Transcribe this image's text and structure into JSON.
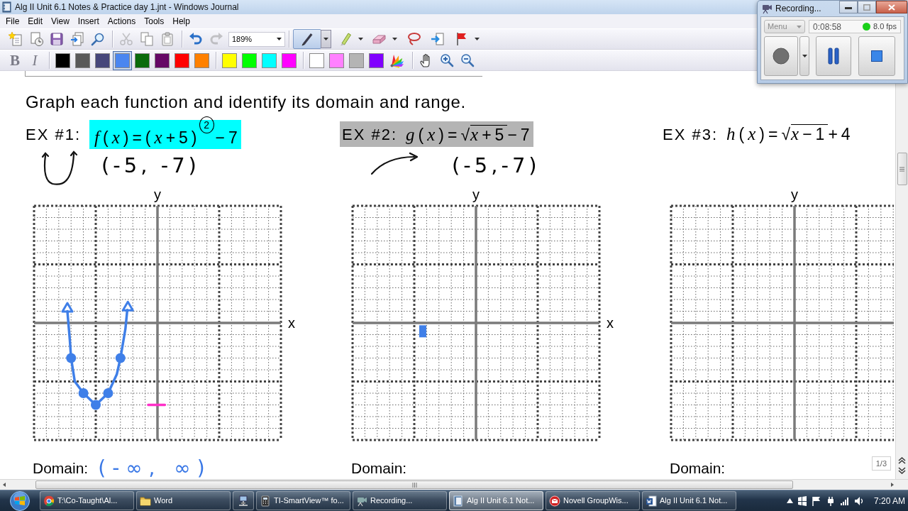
{
  "window": {
    "title": "Alg II Unit 6.1 Notes & Practice day 1.jnt - Windows Journal"
  },
  "menu": [
    "File",
    "Edit",
    "View",
    "Insert",
    "Actions",
    "Tools",
    "Help"
  ],
  "toolbar": {
    "groups": [
      [
        {
          "kind": "new-note",
          "disabled": false
        },
        {
          "kind": "open",
          "disabled": false
        },
        {
          "kind": "save",
          "disabled": false
        },
        {
          "kind": "send",
          "disabled": false
        },
        {
          "kind": "find",
          "disabled": false
        }
      ],
      [
        {
          "kind": "cut",
          "disabled": true
        },
        {
          "kind": "copy",
          "disabled": false
        },
        {
          "kind": "paste",
          "disabled": false
        }
      ],
      [
        {
          "kind": "undo",
          "disabled": false
        },
        {
          "kind": "redo",
          "disabled": true
        }
      ]
    ],
    "zoom": "189%",
    "tools": [
      {
        "kind": "pen",
        "selected": true,
        "dropdown": true
      },
      {
        "kind": "highlighter",
        "selected": false,
        "dropdown": true
      },
      {
        "kind": "eraser",
        "selected": false,
        "dropdown": true
      },
      {
        "kind": "lasso",
        "selected": false,
        "dropdown": false
      },
      {
        "kind": "insert-space",
        "selected": false,
        "dropdown": false
      },
      {
        "kind": "flag",
        "selected": false,
        "dropdown": true
      }
    ]
  },
  "format_bar": {
    "buttons": [
      {
        "label": "B",
        "disabled": true
      },
      {
        "label": "I",
        "disabled": true
      }
    ],
    "color_groups": [
      [
        {
          "color": "#000000",
          "selected": false
        },
        {
          "color": "#595959",
          "selected": false
        },
        {
          "color": "#46467a",
          "selected": false
        },
        {
          "color": "#4a86f0",
          "selected": true
        },
        {
          "color": "#0b6b0b",
          "selected": false
        },
        {
          "color": "#660866",
          "selected": false
        },
        {
          "color": "#ff0000",
          "selected": false
        },
        {
          "color": "#ff8000",
          "selected": false
        }
      ],
      [
        {
          "color": "#ffff00",
          "selected": false
        },
        {
          "color": "#00ff00",
          "selected": false
        },
        {
          "color": "#00ffff",
          "selected": false
        },
        {
          "color": "#ff00ff",
          "selected": false
        }
      ],
      [
        {
          "color": "#ffffff",
          "selected": false
        },
        {
          "color": "#ff80ff",
          "selected": false
        },
        {
          "color": "#b4b4b4",
          "selected": false
        },
        {
          "color": "#8000ff",
          "selected": false
        }
      ]
    ]
  },
  "page": {
    "instruction": "Graph each function and identify its domain and range.",
    "examples": [
      {
        "label": "EX #1:",
        "formula": {
          "before": "*f*(*x*)=(*x*+5)$^{2}$−7"
        },
        "exponent_circled": true,
        "highlight": {
          "color": "#00ffff",
          "kind": "formula"
        },
        "sketch": {
          "kind": "parabola"
        },
        "vertex_note": "(-5, -7)",
        "graph": {
          "y_label": "y",
          "x_label": "x",
          "kind": "parabola"
        },
        "domain": {
          "label": "Domain:",
          "answer": "(-∞, ∞)"
        }
      },
      {
        "label": "EX #2:",
        "formula": {
          "before": "*g*(*x*)=√",
          "radicand": "*x*+5",
          "after": "−7"
        },
        "highlight": {
          "color": "#b4b4b4",
          "kind": "band"
        },
        "sketch": {
          "kind": "arrow"
        },
        "vertex_note": "(-5,-7)",
        "graph": {
          "y_label": "y",
          "x_label": "x",
          "kind": "cursor"
        },
        "domain": {
          "label": "Domain:"
        }
      },
      {
        "label": "EX #3:",
        "formula": {
          "before": "*h*(*x*)=√",
          "radicand": "*x*−1",
          "after": "+4"
        },
        "graph": {
          "y_label": "y"
        },
        "domain": {
          "label": "Domain:"
        }
      }
    ]
  },
  "page_indicator": "1/3",
  "recorder": {
    "title": "Recording...",
    "menu": {
      "label": "Menu",
      "disabled": true
    },
    "time": "0:08:58",
    "recording": true,
    "fps": "8.0 fps"
  },
  "taskbar": {
    "items": [
      {
        "kind": "browser",
        "label": "T:\\Co-Taught\\Al...",
        "selected": false
      },
      {
        "kind": "folder",
        "label": "Word",
        "selected": false
      },
      {
        "kind": "network",
        "selected": false
      },
      {
        "kind": "calculator",
        "label": "TI-SmartView™ fo...",
        "selected": false
      },
      {
        "kind": "recorder",
        "label": "Recording...",
        "selected": false
      },
      {
        "kind": "journal",
        "label": "Alg II Unit 6.1 Not...",
        "selected": true
      },
      {
        "kind": "mail",
        "label": "Novell GroupWis...",
        "selected": false
      },
      {
        "kind": "document",
        "label": "Alg II Unit 6.1 Not...",
        "selected": false
      }
    ],
    "clock": "7:20 AM"
  }
}
